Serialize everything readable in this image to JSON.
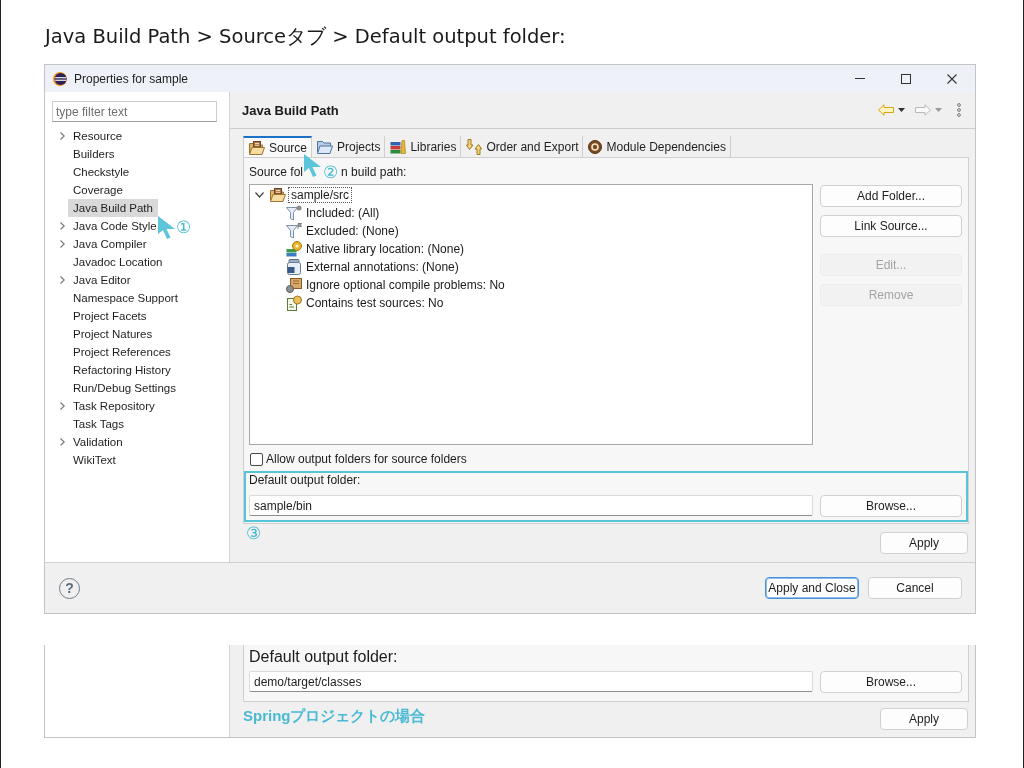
{
  "heading": "Java Build Path > Sourceタブ > Default output folder:",
  "window": {
    "title": "Properties for sample"
  },
  "sidebar": {
    "filter": {
      "placeholder": "type filter text"
    },
    "items": [
      {
        "label": "Resource",
        "expandable": true,
        "selected": false
      },
      {
        "label": "Builders",
        "expandable": false,
        "selected": false
      },
      {
        "label": "Checkstyle",
        "expandable": false,
        "selected": false
      },
      {
        "label": "Coverage",
        "expandable": false,
        "selected": false
      },
      {
        "label": "Java Build Path",
        "expandable": false,
        "selected": true,
        "callout": "①"
      },
      {
        "label": "Java Code Style",
        "expandable": true,
        "selected": false
      },
      {
        "label": "Java Compiler",
        "expandable": true,
        "selected": false
      },
      {
        "label": "Javadoc Location",
        "expandable": false,
        "selected": false
      },
      {
        "label": "Java Editor",
        "expandable": true,
        "selected": false
      },
      {
        "label": "Namespace Support",
        "expandable": false,
        "selected": false
      },
      {
        "label": "Project Facets",
        "expandable": false,
        "selected": false
      },
      {
        "label": "Project Natures",
        "expandable": false,
        "selected": false
      },
      {
        "label": "Project References",
        "expandable": false,
        "selected": false
      },
      {
        "label": "Refactoring History",
        "expandable": false,
        "selected": false
      },
      {
        "label": "Run/Debug Settings",
        "expandable": false,
        "selected": false
      },
      {
        "label": "Task Repository",
        "expandable": true,
        "selected": false
      },
      {
        "label": "Task Tags",
        "expandable": false,
        "selected": false
      },
      {
        "label": "Validation",
        "expandable": true,
        "selected": false
      },
      {
        "label": "WikiText",
        "expandable": false,
        "selected": false
      }
    ]
  },
  "page": {
    "title": "Java Build Path",
    "nav": {
      "back_enabled": true,
      "forward_enabled": false
    }
  },
  "tabs": [
    {
      "label": "Source",
      "kind": "source",
      "selected": true
    },
    {
      "label": "Projects",
      "kind": "projects",
      "selected": false
    },
    {
      "label": "Libraries",
      "kind": "libraries",
      "selected": false
    },
    {
      "label": "Order and Export",
      "kind": "order",
      "selected": false
    },
    {
      "label": "Module Dependencies",
      "kind": "modules",
      "selected": false
    }
  ],
  "source_folders_label": {
    "parts": [
      "Source fol",
      "n build path:"
    ],
    "callout": "②"
  },
  "tree": {
    "label": "sample/src",
    "expanded": true,
    "focused": true,
    "children": [
      {
        "label": "Included: (All)",
        "kind": "included"
      },
      {
        "label": "Excluded: (None)",
        "kind": "excluded"
      },
      {
        "label": "Native library location: (None)",
        "kind": "native"
      },
      {
        "label": "External annotations: (None)",
        "kind": "annotations"
      },
      {
        "label": "Ignore optional compile problems: No",
        "kind": "optional"
      },
      {
        "label": "Contains test sources: No",
        "kind": "test"
      }
    ]
  },
  "side_buttons": [
    {
      "label": "Add Folder...",
      "disabled": false
    },
    {
      "label": "Link Source...",
      "disabled": false
    },
    {
      "label": "Edit...",
      "disabled": true
    },
    {
      "label": "Remove",
      "disabled": true
    }
  ],
  "allow_output": {
    "label": "Allow output folders for source folders",
    "checked": false
  },
  "output": {
    "label": "Default output folder:",
    "value": "sample/bin",
    "button": "Browse...",
    "highlighted": true,
    "callout": "③"
  },
  "apply_button": "Apply",
  "footer": {
    "help": "?",
    "buttons": [
      {
        "label": "Apply and Close",
        "default": true
      },
      {
        "label": "Cancel",
        "default": false
      }
    ]
  },
  "spring_example": {
    "label": "Default output folder:",
    "value": "demo/target/classes",
    "button": "Browse...",
    "caption": "Springプロジェクトの場合",
    "apply_button": "Apply"
  }
}
